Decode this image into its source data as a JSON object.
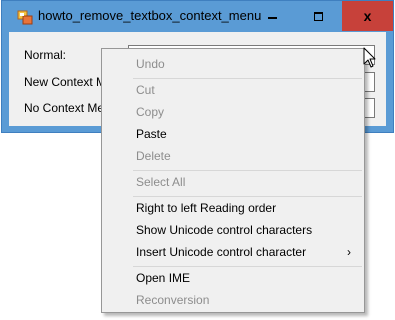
{
  "window": {
    "title": "howto_remove_textbox_context_menu",
    "title_bar_color": "#5a9bd5",
    "close_button_color": "#c7413a",
    "minimize_glyph": "minimize-icon",
    "maximize_glyph": "maximize-icon",
    "close_glyph": "close-icon",
    "close_symbol": "x"
  },
  "form": {
    "fields": [
      {
        "label": "Normal:",
        "value": ""
      },
      {
        "label": "New Context Me",
        "value": ""
      },
      {
        "label": "No Context Menu",
        "value": ""
      }
    ]
  },
  "context_menu": {
    "items": [
      {
        "label": "Undo",
        "enabled": false
      },
      {
        "label": "Cut",
        "enabled": false
      },
      {
        "label": "Copy",
        "enabled": false
      },
      {
        "label": "Paste",
        "enabled": true
      },
      {
        "label": "Delete",
        "enabled": false
      },
      {
        "label": "Select All",
        "enabled": false
      },
      {
        "label": "Right to left Reading order",
        "enabled": true
      },
      {
        "label": "Show Unicode control characters",
        "enabled": true
      },
      {
        "label": "Insert Unicode control character",
        "enabled": true,
        "submenu": true,
        "submenu_glyph": "›"
      },
      {
        "label": "Open IME",
        "enabled": true
      },
      {
        "label": "Reconversion",
        "enabled": false
      }
    ]
  }
}
